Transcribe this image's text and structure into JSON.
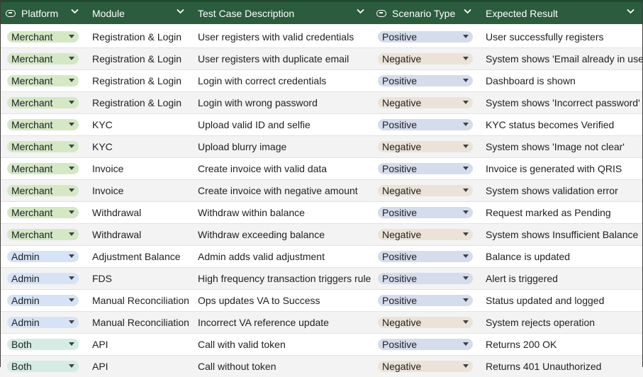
{
  "colors": {
    "header_bg": "#2a5c3d",
    "merchant_chip": "#d4e8c6",
    "admin_chip": "#d6e3f6",
    "both_chip": "#d4ece3",
    "positive_chip": "#d5dceb",
    "negative_chip": "#ece3d8"
  },
  "columns": [
    {
      "label": "Platform",
      "icon": "dropdown-column-icon"
    },
    {
      "label": "Module"
    },
    {
      "label": "Test Case Description"
    },
    {
      "label": "Scenario Type",
      "icon": "dropdown-column-icon"
    },
    {
      "label": "Expected Result"
    }
  ],
  "rows": [
    {
      "platform": "Merchant",
      "module": "Registration & Login",
      "description": "User registers with valid credentials",
      "scenario": "Positive",
      "expected": "User successfully registers"
    },
    {
      "platform": "Merchant",
      "module": "Registration & Login",
      "description": "User registers with duplicate email",
      "scenario": "Negative",
      "expected": "System shows 'Email already in use'"
    },
    {
      "platform": "Merchant",
      "module": "Registration & Login",
      "description": "Login with correct credentials",
      "scenario": "Positive",
      "expected": "Dashboard is shown"
    },
    {
      "platform": "Merchant",
      "module": "Registration & Login",
      "description": "Login with wrong password",
      "scenario": "Negative",
      "expected": "System shows 'Incorrect password'"
    },
    {
      "platform": "Merchant",
      "module": "KYC",
      "description": "Upload valid ID and selfie",
      "scenario": "Positive",
      "expected": "KYC status becomes Verified"
    },
    {
      "platform": "Merchant",
      "module": "KYC",
      "description": "Upload blurry image",
      "scenario": "Negative",
      "expected": "System shows 'Image not clear'"
    },
    {
      "platform": "Merchant",
      "module": "Invoice",
      "description": "Create invoice with valid data",
      "scenario": "Positive",
      "expected": "Invoice is generated with QRIS"
    },
    {
      "platform": "Merchant",
      "module": "Invoice",
      "description": "Create invoice with negative amount",
      "scenario": "Negative",
      "expected": "System shows validation error"
    },
    {
      "platform": "Merchant",
      "module": "Withdrawal",
      "description": "Withdraw within balance",
      "scenario": "Positive",
      "expected": "Request marked as Pending"
    },
    {
      "platform": "Merchant",
      "module": "Withdrawal",
      "description": "Withdraw exceeding balance",
      "scenario": "Negative",
      "expected": "System shows Insufficient Balance"
    },
    {
      "platform": "Admin",
      "module": "Adjustment Balance",
      "description": "Admin adds valid adjustment",
      "scenario": "Positive",
      "expected": "Balance is updated"
    },
    {
      "platform": "Admin",
      "module": "FDS",
      "description": "High frequency transaction triggers rule",
      "scenario": "Positive",
      "expected": "Alert is triggered"
    },
    {
      "platform": "Admin",
      "module": "Manual Reconciliation",
      "description": "Ops updates VA to Success",
      "scenario": "Positive",
      "expected": "Status updated and logged"
    },
    {
      "platform": "Admin",
      "module": "Manual Reconciliation",
      "description": "Incorrect VA reference update",
      "scenario": "Negative",
      "expected": "System rejects operation"
    },
    {
      "platform": "Both",
      "module": "API",
      "description": "Call with valid token",
      "scenario": "Positive",
      "expected": "Returns 200 OK"
    },
    {
      "platform": "Both",
      "module": "API",
      "description": "Call without token",
      "scenario": "Negative",
      "expected": "Returns 401 Unauthorized"
    }
  ]
}
